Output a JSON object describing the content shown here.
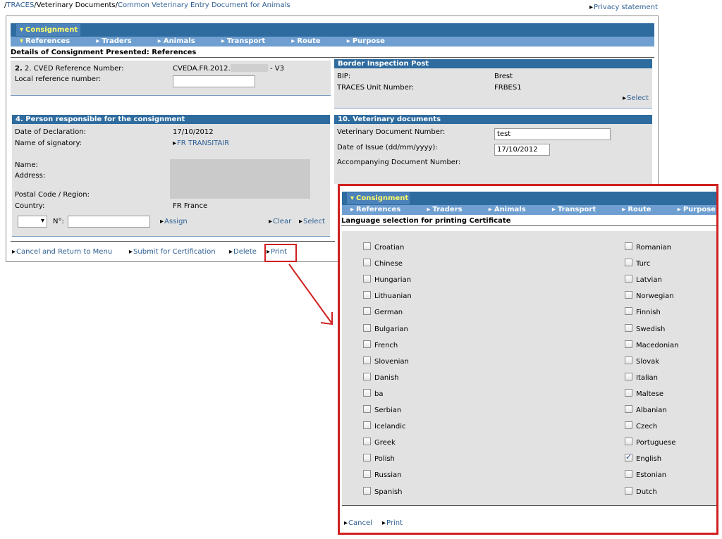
{
  "breadcrumb": {
    "sep": "/",
    "root": "TRACES",
    "current": "Veterinary Documents",
    "page": "Common Veterinary Entry Document for Animals"
  },
  "privacy": "Privacy statement",
  "nav": {
    "top_tab": "Consignment",
    "sub_tabs": [
      "References",
      "Traders",
      "Animals",
      "Transport",
      "Route",
      "Purpose"
    ]
  },
  "main": {
    "section_title": "Details of Consignment Presented: References",
    "box2": {
      "cved_label": "2. CVED Reference Number:",
      "cved_value": "CVEDA.FR.2012.",
      "cved_suffix": "- V3",
      "local_ref_label": "Local reference number:",
      "local_ref_value": ""
    },
    "bip": {
      "title": "Border Inspection Post",
      "bip_label": "BIP:",
      "bip_value": "Brest",
      "unit_label": "TRACES Unit Number:",
      "unit_value": "FRBES1",
      "select": "Select"
    },
    "person": {
      "title": "4. Person responsible for the consignment",
      "date_label": "Date of Declaration:",
      "date_value": "17/10/2012",
      "signatory_label": "Name of signatory:",
      "signatory_value": "FR TRANSITAIR",
      "name_label": "Name:",
      "address_label": "Address:",
      "postal_label": "Postal Code / Region:",
      "country_label": "Country:",
      "country_value": "FR France",
      "no_label": "N°:",
      "no_value": "",
      "assign": "Assign",
      "clear": "Clear",
      "select": "Select"
    },
    "vet_docs": {
      "title": "10. Veterinary documents",
      "doc_number_label": "Veterinary Document Number:",
      "doc_number_value": "test",
      "issue_label": "Date of Issue (dd/mm/yyyy):",
      "issue_value": "17/10/2012",
      "accompanying_label": "Accompanying Document Number:"
    },
    "actions": {
      "cancel": "Cancel and Return to Menu",
      "submit": "Submit for Certification",
      "delete": "Delete",
      "print": "Print"
    }
  },
  "popup": {
    "section_title": "Language selection for printing Certificate",
    "left_languages": [
      {
        "label": "Croatian",
        "checked": false
      },
      {
        "label": "Chinese",
        "checked": false
      },
      {
        "label": "Hungarian",
        "checked": false
      },
      {
        "label": "Lithuanian",
        "checked": false
      },
      {
        "label": "German",
        "checked": false
      },
      {
        "label": "Bulgarian",
        "checked": false
      },
      {
        "label": "French",
        "checked": false
      },
      {
        "label": "Slovenian",
        "checked": false
      },
      {
        "label": "Danish",
        "checked": false
      },
      {
        "label": "ba",
        "checked": false
      },
      {
        "label": "Serbian",
        "checked": false
      },
      {
        "label": "Icelandic",
        "checked": false
      },
      {
        "label": "Greek",
        "checked": false
      },
      {
        "label": "Polish",
        "checked": false
      },
      {
        "label": "Russian",
        "checked": false
      },
      {
        "label": "Spanish",
        "checked": false
      }
    ],
    "right_languages": [
      {
        "label": "Romanian",
        "checked": false
      },
      {
        "label": "Turc",
        "checked": false
      },
      {
        "label": "Latvian",
        "checked": false
      },
      {
        "label": "Norwegian",
        "checked": false
      },
      {
        "label": "Finnish",
        "checked": false
      },
      {
        "label": "Swedish",
        "checked": false
      },
      {
        "label": "Macedonian",
        "checked": false
      },
      {
        "label": "Slovak",
        "checked": false
      },
      {
        "label": "Italian",
        "checked": false
      },
      {
        "label": "Maltese",
        "checked": false
      },
      {
        "label": "Albanian",
        "checked": false
      },
      {
        "label": "Czech",
        "checked": false
      },
      {
        "label": "Portuguese",
        "checked": false
      },
      {
        "label": "English",
        "checked": true
      },
      {
        "label": "Estonian",
        "checked": false
      },
      {
        "label": "Dutch",
        "checked": false
      }
    ],
    "cancel": "Cancel",
    "print": "Print"
  },
  "colors": {
    "header_blue": "#2e6b9f",
    "subnav_blue": "#6f9fd0",
    "active_tab_text": "#ffff66",
    "link_blue": "#2d5f93",
    "highlight_red": "#d02020",
    "panel_gray": "#e2e2e2"
  }
}
